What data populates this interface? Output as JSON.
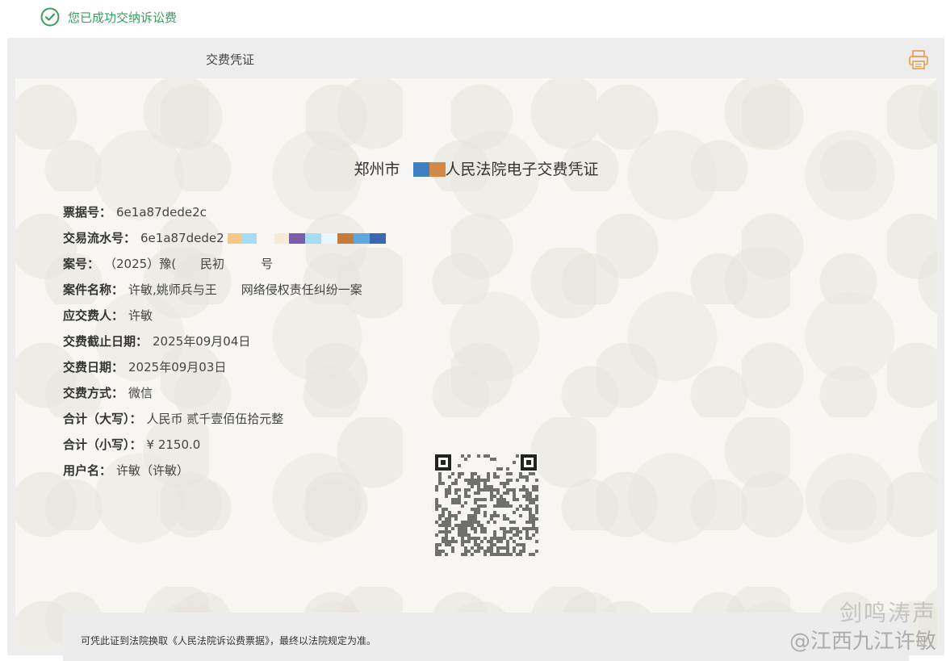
{
  "success_message": "您已成功交纳诉讼费",
  "card_title": "交费凭证",
  "receipt": {
    "title_prefix": "郑州市",
    "title_suffix": "人民法院电子交费凭证",
    "fields": [
      {
        "label": "票据号：",
        "value": "6e1a87dede2c"
      },
      {
        "label": "交易流水号：",
        "value": "6e1a87dede2"
      },
      {
        "label": "案号：",
        "value": "（2025）豫(　　民初　　　号"
      },
      {
        "label": "案件名称：",
        "value": "许敏,姚师兵与王　　网络侵权责任纠纷一案"
      },
      {
        "label": "应交费人：",
        "value": "许敏"
      },
      {
        "label": "交费截止日期：",
        "value": "2025年09月04日"
      },
      {
        "label": "交费日期：",
        "value": "2025年09月03日"
      },
      {
        "label": "交费方式：",
        "value": "微信"
      },
      {
        "label": "合计（大写）：",
        "value": "人民币 贰千壹佰伍拾元整"
      },
      {
        "label": "合计（小写）：",
        "value": "¥ 2150.0"
      },
      {
        "label": "用户名：",
        "value": "许敏（许敏）"
      }
    ],
    "note": "可凭此证到法院换取《人民法院诉讼费票据》，最终以法院规定为准。"
  },
  "watermark": {
    "line1": "剑鸣涛声",
    "line2": "@江西九江许敏"
  },
  "colors": {
    "success_green": "#35a05f",
    "print_icon": "#e8a35a",
    "card_bg": "#ededed",
    "paper_bg": "#f7f6f2"
  }
}
